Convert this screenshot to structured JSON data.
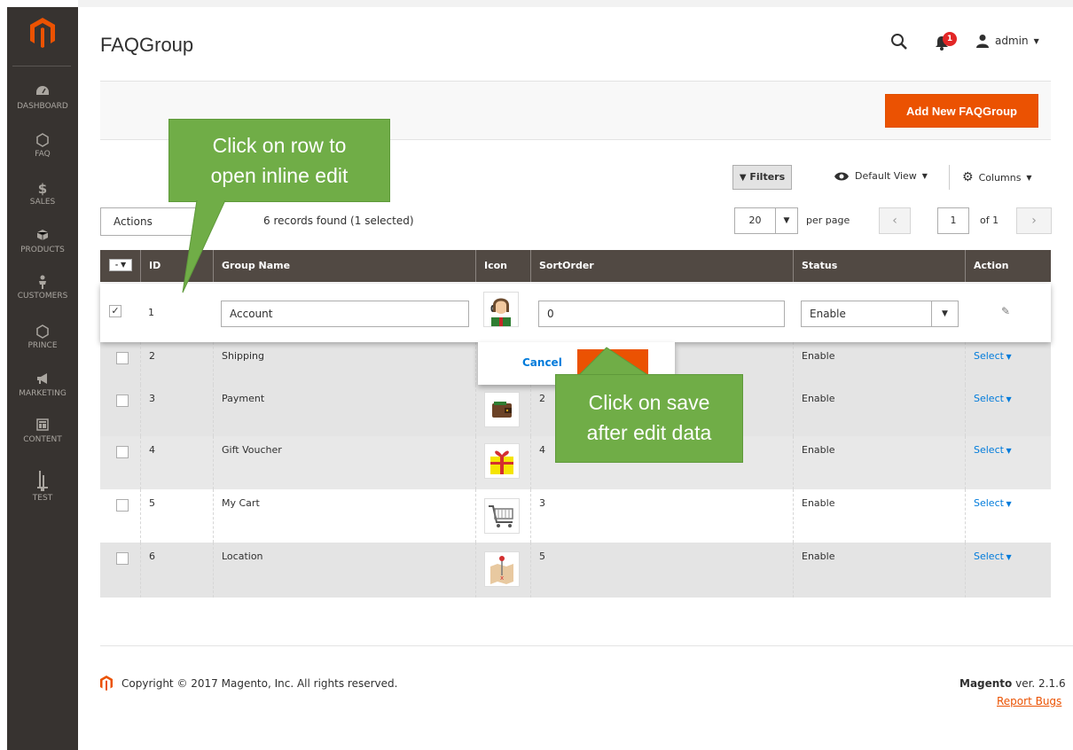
{
  "sidebar": {
    "items": [
      {
        "label": "DASHBOARD",
        "icon": "dashboard-icon"
      },
      {
        "label": "FAQ",
        "icon": "hexagon-icon"
      },
      {
        "label": "SALES",
        "icon": "dollar-icon"
      },
      {
        "label": "PRODUCTS",
        "icon": "box-icon"
      },
      {
        "label": "CUSTOMERS",
        "icon": "person-icon"
      },
      {
        "label": "PRINCE",
        "icon": "hexagon-icon"
      },
      {
        "label": "MARKETING",
        "icon": "megaphone-icon"
      },
      {
        "label": "CONTENT",
        "icon": "layout-icon"
      },
      {
        "label": "TEST",
        "icon": "tower-icon"
      }
    ]
  },
  "header": {
    "title": "FAQGroup",
    "notification_count": "1",
    "user": "admin"
  },
  "action_bar": {
    "add_button": "Add New FAQGroup"
  },
  "toolbar": {
    "filters": "Filters",
    "view": "Default View",
    "columns": "Columns",
    "actions": "Actions",
    "records": "6 records found (1 selected)",
    "per_page_value": "20",
    "per_page_label": "per page",
    "page": "1",
    "of_pages": "of 1"
  },
  "grid": {
    "columns": [
      "ID",
      "Group Name",
      "Icon",
      "SortOrder",
      "Status",
      "Action"
    ],
    "edit_row": {
      "id": "1",
      "group_name": "Account",
      "sort_order": "0",
      "status": "Enable",
      "cancel": "Cancel"
    },
    "rows": [
      {
        "id": "2",
        "name": "Shipping",
        "sort": "",
        "status": "Enable",
        "action": "Select"
      },
      {
        "id": "3",
        "name": "Payment",
        "sort": "2",
        "status": "Enable",
        "action": "Select"
      },
      {
        "id": "4",
        "name": "Gift Voucher",
        "sort": "4",
        "status": "Enable",
        "action": "Select"
      },
      {
        "id": "5",
        "name": "My Cart",
        "sort": "3",
        "status": "Enable",
        "action": "Select"
      },
      {
        "id": "6",
        "name": "Location",
        "sort": "5",
        "status": "Enable",
        "action": "Select"
      }
    ]
  },
  "callouts": {
    "row": [
      "Click on row to",
      "open inline edit"
    ],
    "save": [
      "Click on save",
      "after edit data"
    ]
  },
  "footer": {
    "copyright": "Copyright © 2017 Magento, Inc. All rights reserved.",
    "brand": "Magento",
    "version": " ver. 2.1.6",
    "report_bugs": "Report Bugs"
  },
  "colors": {
    "accent": "#eb5202",
    "sidebar": "#373330",
    "grid_header": "#514943",
    "callout": "#70ad47",
    "link": "#007bdb"
  }
}
